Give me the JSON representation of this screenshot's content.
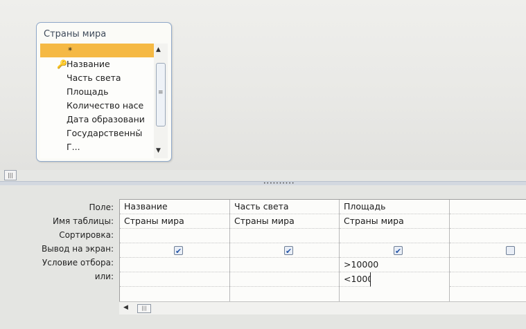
{
  "table_box": {
    "title": "Страны мира",
    "fields": [
      {
        "label": "*",
        "selected": true,
        "icon": ""
      },
      {
        "label": "Название",
        "selected": false,
        "icon": "key-icon"
      },
      {
        "label": "Часть света",
        "selected": false,
        "icon": ""
      },
      {
        "label": "Площадь",
        "selected": false,
        "icon": ""
      },
      {
        "label": "Количество насе",
        "selected": false,
        "icon": ""
      },
      {
        "label": "Дата образовани",
        "selected": false,
        "icon": ""
      },
      {
        "label": "Государственны̆",
        "selected": false,
        "icon": ""
      },
      {
        "label": "Г...",
        "selected": false,
        "icon": ""
      }
    ]
  },
  "grid": {
    "row_labels": [
      "Поле:",
      "Имя таблицы:",
      "Сортировка:",
      "Вывод на экран:",
      "Условие отбора:",
      "или:"
    ],
    "columns": [
      {
        "field": "Название",
        "table": "Страны мира",
        "sort": "",
        "show": true,
        "criteria": "",
        "or": ""
      },
      {
        "field": "Часть света",
        "table": "Страны мира",
        "sort": "",
        "show": true,
        "criteria": "",
        "or": ""
      },
      {
        "field": "Площадь",
        "table": "Страны мира",
        "sort": "",
        "show": true,
        "criteria": ">10000",
        "or": "<1000"
      },
      {
        "field": "",
        "table": "",
        "sort": "",
        "show": false,
        "criteria": "",
        "or": ""
      }
    ]
  },
  "colors": {
    "selected_row": "#f5b944",
    "checkbox_check": "#2757a8",
    "table_border": "#8fa8c9"
  }
}
